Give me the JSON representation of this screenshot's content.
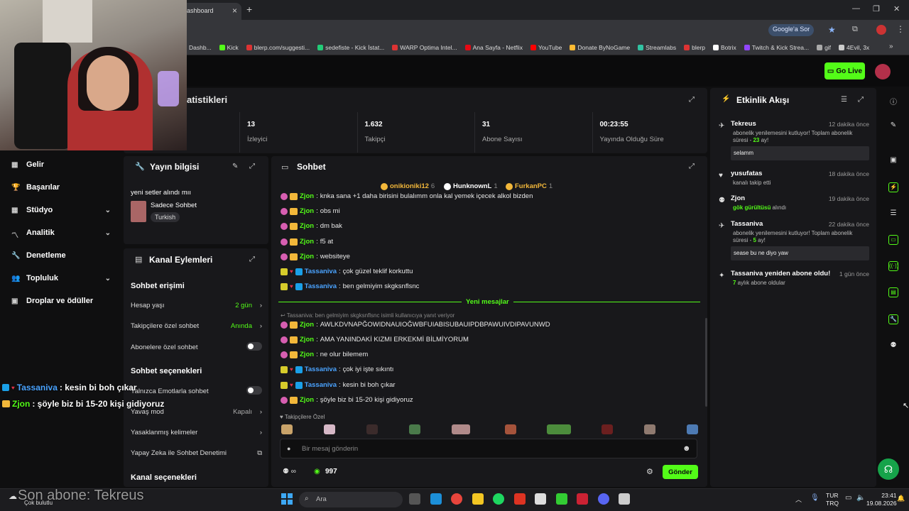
{
  "browser": {
    "tab_title": "ashboard",
    "bookmarks": [
      {
        "label": "Dashb...",
        "color": "#53fc18"
      },
      {
        "label": "Kick",
        "color": "#53fc18"
      },
      {
        "label": "blerp.com/suggesti...",
        "color": "#d33"
      },
      {
        "label": "sedefiste - Kick İstat...",
        "color": "#2c7"
      },
      {
        "label": "WARP Optima Intel...",
        "color": "#d33"
      },
      {
        "label": "Ana Sayfa - Netflix",
        "color": "#e50914"
      },
      {
        "label": "YouTube",
        "color": "#f00"
      },
      {
        "label": "Donate ByNoGame",
        "color": "#fb3"
      },
      {
        "label": "Streamlabs",
        "color": "#31c3a2"
      },
      {
        "label": "blerp",
        "color": "#d33"
      },
      {
        "label": "Botrix",
        "color": "#fff"
      },
      {
        "label": "Twitch & Kick Strea...",
        "color": "#9146ff"
      },
      {
        "label": "gif",
        "color": "#aaa"
      },
      {
        "label": "4Evil, 3x",
        "color": "#ccc"
      }
    ],
    "google_sor": "Google'a Sor"
  },
  "header": {
    "go_live": "Go Live"
  },
  "stats": {
    "title": "atistikleri",
    "items": [
      {
        "value": "13",
        "label": "İzleyici"
      },
      {
        "value": "1.632",
        "label": "Takipçi"
      },
      {
        "value": "31",
        "label": "Abone Sayısı"
      },
      {
        "value": "00:23:55",
        "label": "Yayında Olduğu Süre"
      }
    ]
  },
  "sidebar": {
    "items": [
      {
        "label": "Gelir",
        "chevron": false
      },
      {
        "label": "Başarılar",
        "chevron": false
      },
      {
        "label": "Stüdyo",
        "chevron": true
      },
      {
        "label": "Analitik",
        "chevron": true
      },
      {
        "label": "Denetleme",
        "chevron": false
      },
      {
        "label": "Topluluk",
        "chevron": true
      },
      {
        "label": "Droplar ve ödüller",
        "chevron": false
      }
    ]
  },
  "yayin": {
    "title": "Yayın bilgisi",
    "stream_title": "yeni setler alındı mıı",
    "category": "Sadece Sohbet",
    "tag": "Turkish"
  },
  "kanal": {
    "title": "Kanal Eylemleri",
    "section1": "Sohbet erişimi",
    "rows1": [
      {
        "label": "Hesap yaşı",
        "value": "2 gün"
      },
      {
        "label": "Takipçilere özel sohbet",
        "value": "Anında"
      },
      {
        "label": "Abonelere özel sohbet",
        "value": ""
      }
    ],
    "section2": "Sohbet seçenekleri",
    "rows2": [
      {
        "label": "Yalnızca Emotlarla sohbet",
        "value": ""
      },
      {
        "label": "Yavaş mod",
        "value": "Kapalı"
      },
      {
        "label": "Yasaklanmış kelimeler",
        "value": ""
      },
      {
        "label": "Yapay Zeka ile Sohbet Denetimi",
        "value": ""
      }
    ],
    "section3": "Kanal seçenekleri"
  },
  "chat": {
    "title": "Sohbet",
    "top_gifters": [
      {
        "name": "onikioniki12",
        "count": "6"
      },
      {
        "name": "HunknownL",
        "count": "1"
      },
      {
        "name": "FurkanPC",
        "count": "1"
      }
    ],
    "messages_old": [
      {
        "user": "Zjon",
        "text": "knka sana +1 daha birisini bulalımm onla kal yemek içecek alkol bizden",
        "kind": "z"
      },
      {
        "user": "Zjon",
        "text": "obs mi",
        "kind": "z"
      },
      {
        "user": "Zjon",
        "text": "dm bak",
        "kind": "z"
      },
      {
        "user": "Zjon",
        "text": "f5 at",
        "kind": "z"
      },
      {
        "user": "Zjon",
        "text": "websiteye",
        "kind": "z"
      },
      {
        "user": "Tassaniva",
        "text": "çok güzel teklif korkuttu",
        "kind": "t"
      },
      {
        "user": "Tassaniva",
        "text": "ben gelmiyim skgksnflsnc",
        "kind": "t"
      }
    ],
    "new_messages_label": "Yeni mesajlar",
    "reply_hint": "Tassaniva: ben gelmiyim skgksnflsnc isimli kullanıcıya yanıt veriyor",
    "messages_new": [
      {
        "user": "Zjon",
        "text": "AWLKDVNAPĞOWIDNAUIOĞWBFUIABISUBAUIPDBPAWUIVDIPAVUNWD",
        "kind": "z"
      },
      {
        "user": "Zjon",
        "text": "AMA YANINDAKİ KIZMI ERKEKMİ BİLMİYORUM",
        "kind": "z"
      },
      {
        "user": "Zjon",
        "text": "ne olur bilemem",
        "kind": "z"
      },
      {
        "user": "Tassaniva",
        "text": "çok iyi işte sıkıntı",
        "kind": "t"
      },
      {
        "user": "Tassaniva",
        "text": "kesin bi boh çıkar",
        "kind": "t"
      },
      {
        "user": "Zjon",
        "text": "şöyle biz bi 15-20 kişi gidiyoruz",
        "kind": "z"
      }
    ],
    "follower_only_label": "Takipçilere Özel",
    "input_placeholder": "Bir mesaj gönderin",
    "points": "997",
    "send": "Gönder"
  },
  "activity": {
    "title": "Etkinlik Akışı",
    "items": [
      {
        "name": "Tekreus",
        "time": "12 dakika önce",
        "desc_a": "abonelik yenilemesini kutluyor! Toplam abonelik süresi - ",
        "desc_b": "23",
        "desc_c": " ay!",
        "quote": "selamm"
      },
      {
        "name": "yusufatas",
        "time": "18 dakika önce",
        "desc": "kanalı takip etti"
      },
      {
        "name": "Zjon",
        "time": "19 dakika önce",
        "desc_green": "gök gürültüsü",
        "desc_tail": " alındı"
      },
      {
        "name": "Tassaniva",
        "time": "22 dakika önce",
        "desc_a": "abonelik yenilemesini kutluyor! Toplam abonelik süresi - ",
        "desc_b": "5",
        "desc_c": " ay!",
        "quote": "sease bu ne diyo yaw"
      },
      {
        "name": "Tassaniva yeniden abone oldu!",
        "time": "1 gün önce",
        "desc_green": "7",
        "desc_tail": " aylık abone oldular"
      }
    ]
  },
  "overlay": {
    "lines": [
      {
        "user": "Tassaniva",
        "text": ": kesin bi boh çıkar"
      },
      {
        "user": "Zjon",
        "text": ": şöyle biz bi 15-20 kişi gidiyoruz"
      }
    ],
    "last_sub": "Son abone: Tekreus"
  },
  "taskbar": {
    "weather": "Çok bulutlu",
    "search": "Ara",
    "lang1": "TUR",
    "lang2": "TRQ",
    "time": "23:41",
    "date": "19.08.2026"
  }
}
